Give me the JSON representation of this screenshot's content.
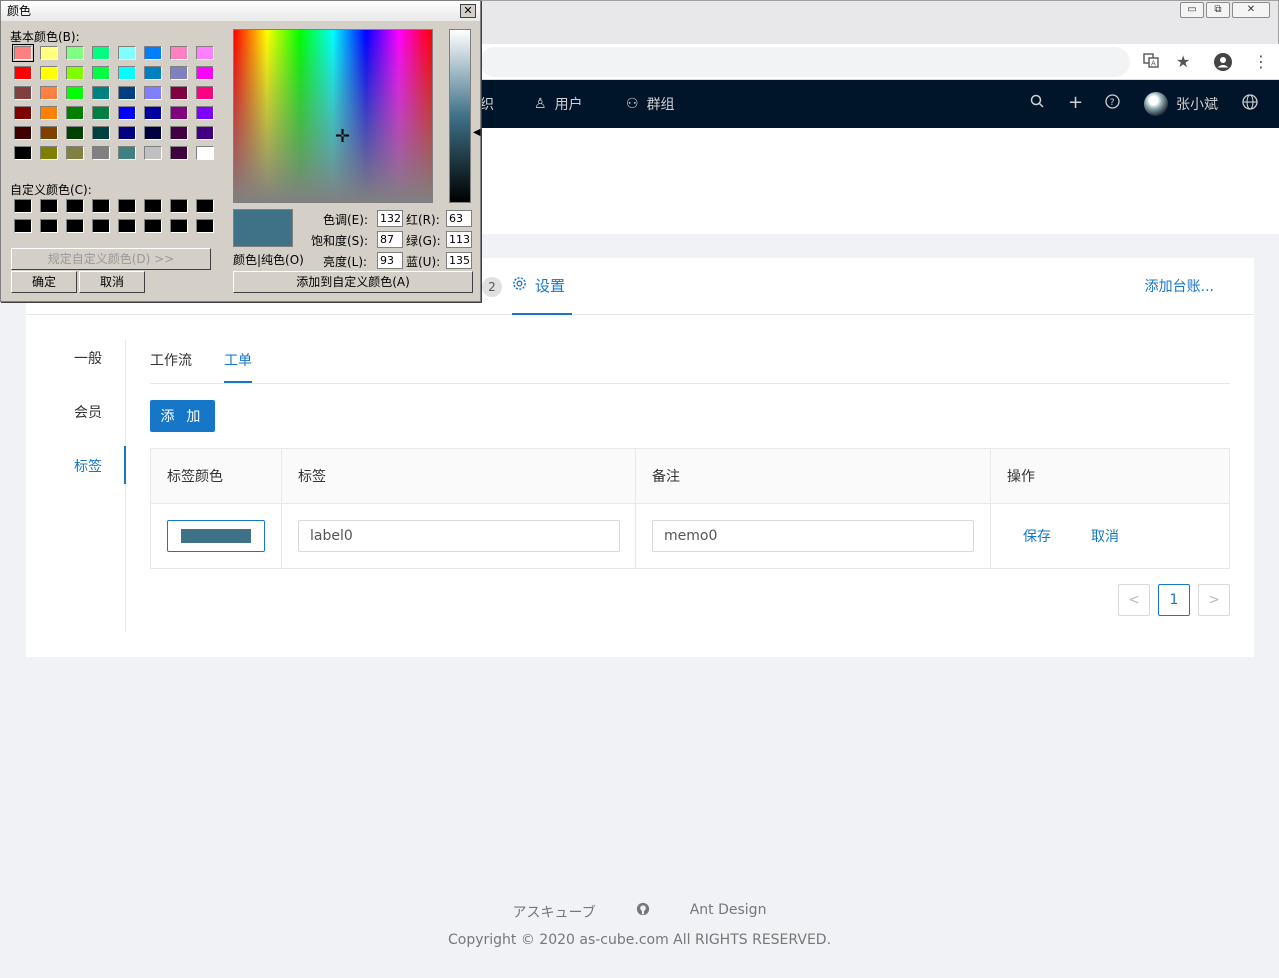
{
  "window": {
    "min": "▭",
    "max": "⧉",
    "close": "✕"
  },
  "browser": {
    "translate_icon": "translate-icon",
    "star_icon": "★",
    "menu_icon": "⋮"
  },
  "appbar": {
    "nav": [
      {
        "label": "织",
        "icon": ""
      },
      {
        "label": "用户",
        "icon": "♙"
      },
      {
        "label": "群组",
        "icon": "⚇"
      }
    ],
    "user_name": "张小斌",
    "icons": {
      "search": "⌕",
      "plus": "+",
      "help": "?",
      "globe": "⊕"
    }
  },
  "card": {
    "tab_badge": "2",
    "tab_settings_label": "设置",
    "add_ledger": "添加台账..."
  },
  "side": {
    "items": [
      "一般",
      "会员",
      "标签"
    ],
    "active": "标签"
  },
  "subtabs": {
    "items": [
      "工作流",
      "工单"
    ],
    "active": "工单"
  },
  "add_button": "添 加",
  "table": {
    "headers": [
      "标签颜色",
      "标签",
      "备注",
      "操作"
    ],
    "row": {
      "color": "#3f7187",
      "label_value": "label0",
      "memo_value": "memo0",
      "save": "保存",
      "cancel": "取消"
    }
  },
  "pager": {
    "prev": "<",
    "page": "1",
    "next": ">"
  },
  "footer": {
    "links": [
      "アスキューブ",
      "Ant Design"
    ],
    "github_icon": "github-icon",
    "copyright": "Copyright © 2020 as-cube.com All RIGHTS RESERVED."
  },
  "dialog": {
    "title": "颜色",
    "close": "✕",
    "basic_colors_label": "基本颜色(B):",
    "custom_colors_label": "自定义颜色(C):",
    "define_custom_btn": "规定自定义颜色(D) >>",
    "ok_btn": "确定",
    "cancel_btn": "取消",
    "add_custom_btn": "添加到自定义颜色(A)",
    "color_solid_label": "颜色|纯色(O)",
    "hue_label": "色调(E):",
    "hue": "132",
    "sat_label": "饱和度(S):",
    "sat": "87",
    "lum_label": "亮度(L):",
    "lum": "93",
    "red_label": "红(R):",
    "red": "63",
    "green_label": "绿(G):",
    "green": "113",
    "blue_label": "蓝(U):",
    "blue": "135",
    "basic_colors": [
      "#ff8080",
      "#ffff80",
      "#80ff80",
      "#00ff80",
      "#80ffff",
      "#0080ff",
      "#ff80c0",
      "#ff80ff",
      "#ff0000",
      "#ffff00",
      "#80ff00",
      "#00ff40",
      "#00ffff",
      "#0080c0",
      "#8080c0",
      "#ff00ff",
      "#804040",
      "#ff8040",
      "#00ff00",
      "#008080",
      "#004080",
      "#8080ff",
      "#800040",
      "#ff0080",
      "#800000",
      "#ff8000",
      "#008000",
      "#008040",
      "#0000ff",
      "#0000a0",
      "#800080",
      "#8000ff",
      "#400000",
      "#804000",
      "#004000",
      "#004040",
      "#000080",
      "#000040",
      "#400040",
      "#400080",
      "#000000",
      "#808000",
      "#808040",
      "#808080",
      "#408080",
      "#c0c0c0",
      "#400040",
      "#ffffff"
    ],
    "custom_colors": [
      "#000000",
      "#000000",
      "#000000",
      "#000000",
      "#000000",
      "#000000",
      "#000000",
      "#000000",
      "#000000",
      "#000000",
      "#000000",
      "#000000",
      "#000000",
      "#000000",
      "#000000",
      "#000000"
    ]
  }
}
